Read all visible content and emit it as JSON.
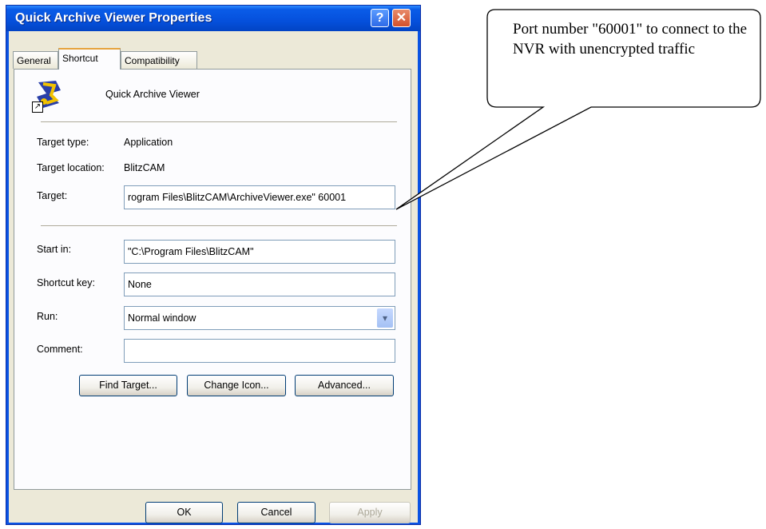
{
  "window": {
    "title": "Quick Archive Viewer Properties",
    "help_glyph": "?",
    "close_glyph": "✕"
  },
  "tabs": [
    {
      "label": "General"
    },
    {
      "label": "Shortcut"
    },
    {
      "label": "Compatibility"
    }
  ],
  "shortcut": {
    "app_name": "Quick Archive Viewer",
    "target_type_label": "Target type:",
    "target_type_value": "Application",
    "target_location_label": "Target location:",
    "target_location_value": "BlitzCAM",
    "target_label": "Target:",
    "target_value": "rogram Files\\BlitzCAM\\ArchiveViewer.exe\" 60001",
    "start_in_label": "Start in:",
    "start_in_value": "\"C:\\Program Files\\BlitzCAM\"",
    "shortcut_key_label": "Shortcut key:",
    "shortcut_key_value": "None",
    "run_label": "Run:",
    "run_value": "Normal window",
    "comment_label": "Comment:",
    "comment_value": "",
    "find_target_label": "Find Target...",
    "change_icon_label": "Change Icon...",
    "advanced_label": "Advanced..."
  },
  "footer": {
    "ok_label": "OK",
    "cancel_label": "Cancel",
    "apply_label": "Apply"
  },
  "callout": {
    "text": "Port number \"60001\" to connect to the NVR with unencrypted traffic"
  },
  "icons": [
    "app-icon",
    "shortcut-arrow-icon",
    "help-icon",
    "close-icon",
    "chevron-down-icon"
  ]
}
